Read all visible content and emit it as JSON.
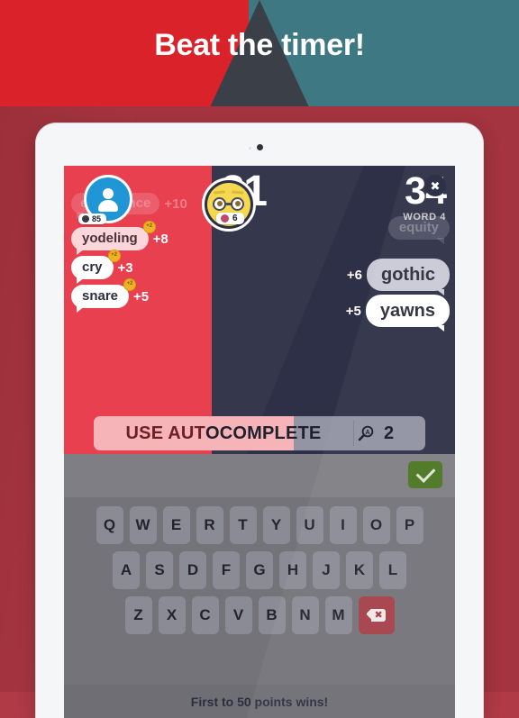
{
  "headline": "Beat the timer!",
  "background": {
    "red": "#d9222a",
    "teal": "#3e7883",
    "triangle": "#3b3f47",
    "lower_red": "#a4343f"
  },
  "device": {
    "frame_color": "#f4f6f8",
    "camera_icon": "camera-dot"
  },
  "game": {
    "left_player": {
      "panel_color": "#e8404f",
      "score": "34",
      "word_label": "WORD 4",
      "avatar_icon": "person-avatar-icon",
      "avatar_badge": "85",
      "badge_icon": "dark-dot-icon",
      "words": [
        {
          "word": "experience",
          "points": "+10",
          "state": "faded",
          "coin": "+2",
          "show_coin": false
        },
        {
          "word": "yodeling",
          "points": "+8",
          "state": "fading",
          "coin": "+2",
          "show_coin": true
        },
        {
          "word": "cry",
          "points": "+3",
          "state": "solid",
          "coin": "+2",
          "show_coin": true
        },
        {
          "word": "snare",
          "points": "+5",
          "state": "solid",
          "coin": "+2",
          "show_coin": true
        }
      ]
    },
    "right_player": {
      "panel_color": "#2e3047",
      "score": "21",
      "avatar_icon": "nerd-emoji-avatar-icon",
      "avatar_badge": "6",
      "badge_icon": "brain-icon",
      "close_icon": "close-x-icon",
      "words": [
        {
          "word": "equity",
          "points": "",
          "state": "faded"
        },
        {
          "word": "gothic",
          "points": "+6",
          "state": "fading"
        },
        {
          "word": "yawns",
          "points": "+5",
          "state": "solid"
        }
      ]
    },
    "autocomplete": {
      "label_highlight": "USE AUT",
      "label_rest": "OCOMPLETE",
      "icon": "magnifier-a-icon",
      "count": "2",
      "fill_color": "#f6b4b9"
    }
  },
  "keyboard": {
    "submit_icon": "checkmark-icon",
    "submit_color": "#4a7620",
    "rows": [
      [
        "Q",
        "W",
        "E",
        "R",
        "T",
        "Y",
        "U",
        "I",
        "O",
        "P"
      ],
      [
        "A",
        "S",
        "D",
        "F",
        "G",
        "H",
        "J",
        "K",
        "L"
      ],
      [
        "Z",
        "X",
        "C",
        "V",
        "B",
        "N",
        "M"
      ]
    ],
    "delete_icon": "backspace-icon",
    "delete_color": "#a4414a",
    "footer": "First to 50 points wins!"
  }
}
